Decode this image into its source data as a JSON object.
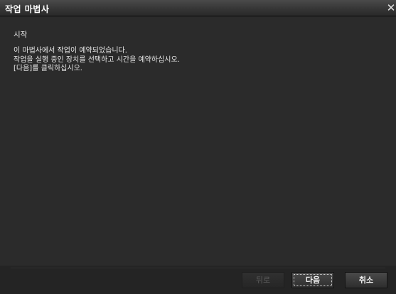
{
  "window": {
    "title": "작업 마법사",
    "close_glyph": "✕"
  },
  "content": {
    "step_title": "시작",
    "lines": [
      "이 마법사에서 작업이 예약되었습니다.",
      "작업을 실행 중인 장치를 선택하고 시간을 예약하십시오.",
      "[다음]를 클릭하십시오."
    ]
  },
  "buttons": {
    "back": "뒤로",
    "next": "다음",
    "cancel": "취소"
  },
  "colors": {
    "background": "#242424",
    "content_background": "#2b2b2b",
    "text": "#e6e6e6",
    "disabled_text": "#5c5c5c"
  },
  "icons": {
    "close": "close-icon"
  }
}
